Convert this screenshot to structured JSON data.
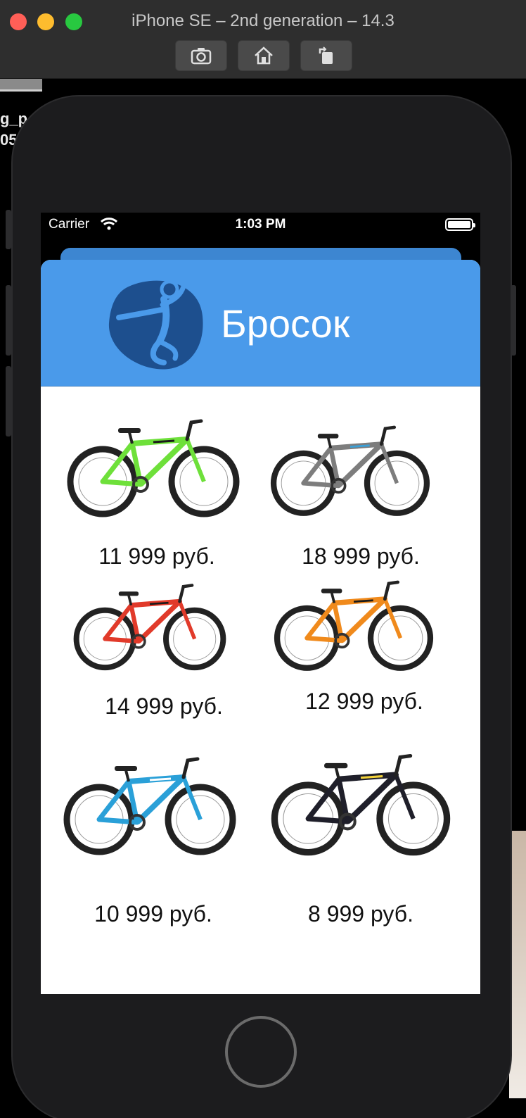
{
  "window": {
    "title": "iPhone SE – 2nd generation – 14.3"
  },
  "toolbar": {
    "screenshot_icon": "camera-icon",
    "home_icon": "home-icon",
    "rotate_icon": "rotate-icon"
  },
  "background": {
    "line1": "g_p",
    "line2": "05"
  },
  "status_bar": {
    "carrier": "Carrier",
    "time": "1:03 PM"
  },
  "header": {
    "title": "Бросок",
    "logo_icon": "handball-player-icon",
    "color": "#4a9aea"
  },
  "products": [
    {
      "price": "11 999 руб.",
      "frame_color": "#6ee03a",
      "accent": "#1a1a1a"
    },
    {
      "price": "18 999 руб.",
      "frame_color": "#7d7d7d",
      "accent": "#3aa0d8"
    },
    {
      "price": "14 999 руб.",
      "frame_color": "#e13a2a",
      "accent": "#1a1a1a"
    },
    {
      "price": "12 999 руб.",
      "frame_color": "#f08a1c",
      "accent": "#1a1a1a"
    },
    {
      "price": "10 999 руб.",
      "frame_color": "#2aa0d8",
      "accent": "#ffffff"
    },
    {
      "price": "8 999 руб.",
      "frame_color": "#1f1f2a",
      "accent": "#f2d23a"
    }
  ]
}
